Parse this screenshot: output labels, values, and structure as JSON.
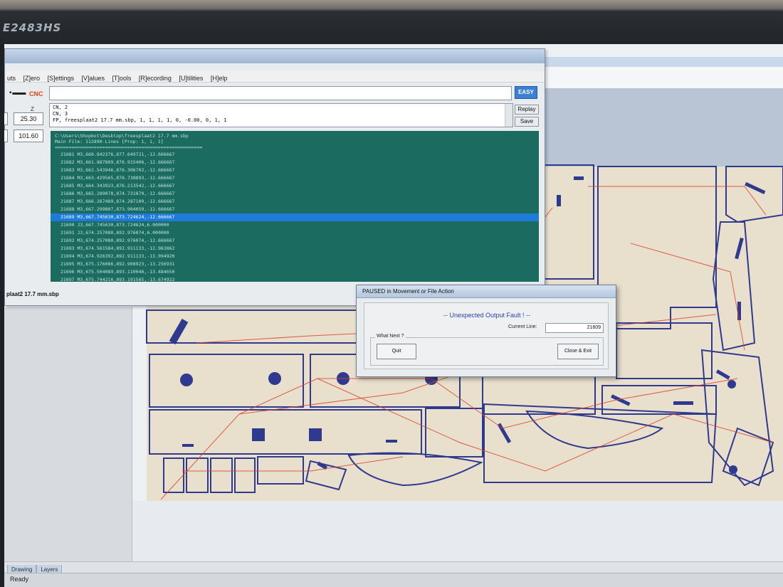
{
  "monitor": {
    "brand": "E2483HS"
  },
  "console": {
    "menu": [
      "uts",
      "[Z]ero",
      "[S]ettings",
      "[V]alues",
      "[T]ools",
      "[R]ecording",
      "[U]tilities",
      "[H]elp"
    ],
    "cnc_label": "CNC",
    "easy_button": "EASY",
    "history": [
      "CN, 2",
      "CN, 3",
      "FP, freesplaat2 17.7 mm.sbp,  1,  1,  1,  1,  0, -0.00, 0, 1,  1"
    ],
    "replay_button": "Replay",
    "save_button": "Save",
    "z_label": "Z",
    "coord_value_1": "25.30",
    "coord_value_2": "101.60",
    "file_path": "C:\\Users\\Shopbot\\Desktop\\freesplaat2 17.7 mm.sbp",
    "main_file": "Main File:  112890-Lines [Prop: 1, 1, 1]",
    "separator": "=====================================================",
    "code_lines": [
      "21681 M3,660.842376,877.649721,-12.666667",
      "21682 M3,661.887809,876.915406,-12.666667",
      "21683 M3,662.543946,876.306702,-12.666667",
      "21684 M3,663.429565,876.738893,-12.666667",
      "21685 M3,664.343923,876.213542,-12.666667",
      "21686 M3,665.289078,874.731879,-12.666667",
      "21687 M3,666.267489,874.287109,-12.666667",
      "21688 M3,667.299807,873.904059,-12.666667",
      "21689 M3,667.745630,873.724624,-12.666667",
      "21690 J3,667.745630,873.724624,6.000000",
      "21691 J3,674.257080,892.976074,6.000000",
      "21692 M3,674.257080,892.976074,-12.666667",
      "21693 M3,674.561584,892.911133,-12.963862",
      "21694 M3,674.926392,892.911133,-13.094920",
      "21695 M3,675.176086,892.908923,-13.256931",
      "21696 M3,675.504089,893.110046,-13.484650",
      "21697 M3,675.744216,893.191565,-13.674922"
    ],
    "file_name": "plaat2 17.7 mm.sbp"
  },
  "dialog": {
    "title": "PAUSED in Movement or File Action",
    "message": "-- Unexpected Output Fault ! --",
    "current_line_label": "Current Line:",
    "current_line_value": "21609",
    "group_label": "What Next ?",
    "quit_button": "Quit",
    "close_exit_button": "Close & Exit"
  },
  "viewer": {
    "tabs": [
      "Drawing",
      "Layers"
    ],
    "status": "Ready"
  },
  "colors": {
    "console_panel": "#1c6b60",
    "highlight": "#1e7bdc",
    "part_outline": "#2f3a8f",
    "toolpath": "#d9462b",
    "sheet": "#e9dfcd"
  }
}
